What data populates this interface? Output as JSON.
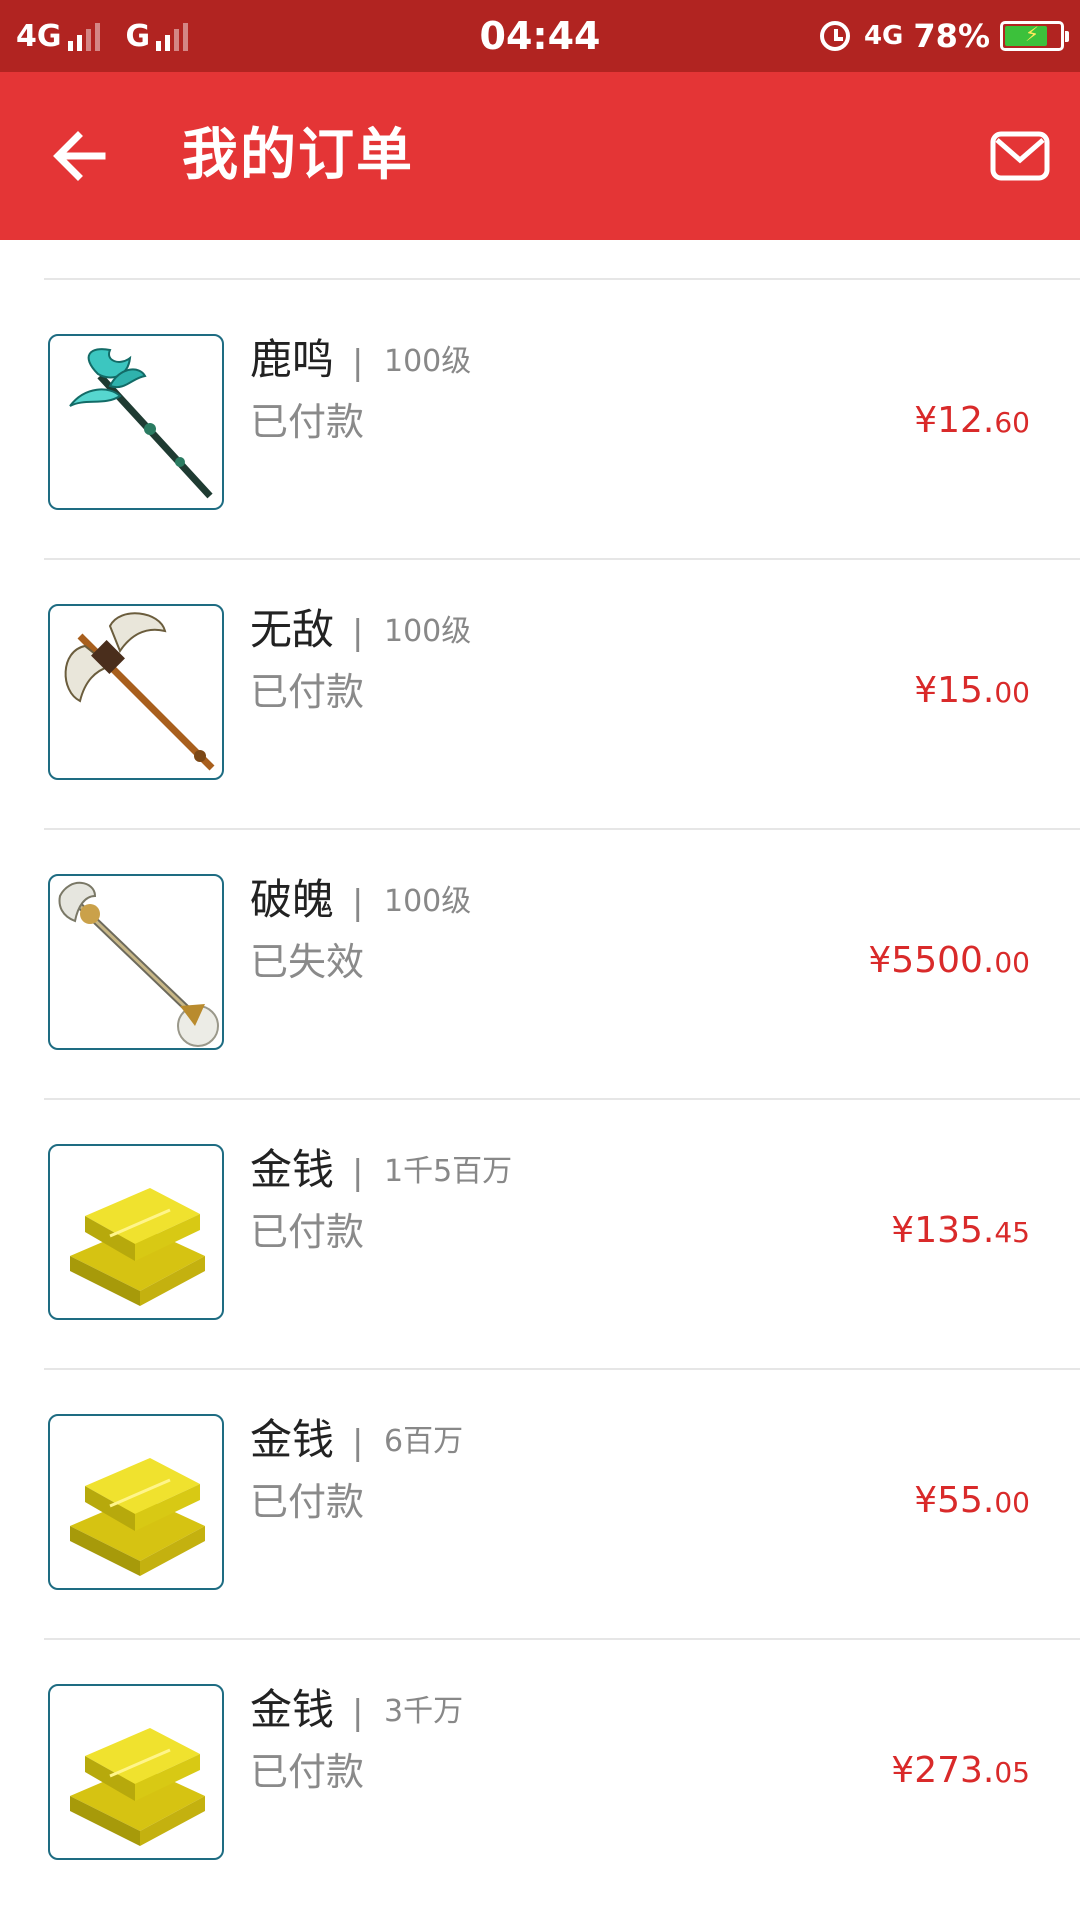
{
  "status_bar": {
    "network1": "4G",
    "network2": "G",
    "time": "04:44",
    "network_right": "4G",
    "battery": "78%",
    "battery_color": "#3cc13b"
  },
  "app_bar": {
    "title": "我的订单",
    "back_icon": "arrow-left-icon",
    "mail_icon": "mail-icon",
    "background": "#e43536"
  },
  "orders": [
    {
      "name": "鹿鸣",
      "sep": "|",
      "level": "100级",
      "status": "已付款",
      "price_main": "¥12.",
      "price_cents": "60",
      "icon": "antler-staff-icon"
    },
    {
      "name": "无敌",
      "sep": "|",
      "level": "100级",
      "status": "已付款",
      "price_main": "¥15.",
      "price_cents": "00",
      "icon": "battle-axe-icon"
    },
    {
      "name": "破魄",
      "sep": "|",
      "level": "100级",
      "status": "已失效",
      "price_main": "¥5500.",
      "price_cents": "00",
      "icon": "double-blade-staff-icon"
    },
    {
      "name": "金钱",
      "sep": "|",
      "level": "1千5百万",
      "status": "已付款",
      "price_main": "¥135.",
      "price_cents": "45",
      "icon": "gold-bars-icon"
    },
    {
      "name": "金钱",
      "sep": "|",
      "level": "6百万",
      "status": "已付款",
      "price_main": "¥55.",
      "price_cents": "00",
      "icon": "gold-bars-icon"
    },
    {
      "name": "金钱",
      "sep": "|",
      "level": "3千万",
      "status": "已付款",
      "price_main": "¥273.",
      "price_cents": "05",
      "icon": "gold-bars-icon"
    }
  ],
  "colors": {
    "price": "#d92a2a",
    "thumb_border": "#1e6c82",
    "status_bar": "#b12421"
  }
}
